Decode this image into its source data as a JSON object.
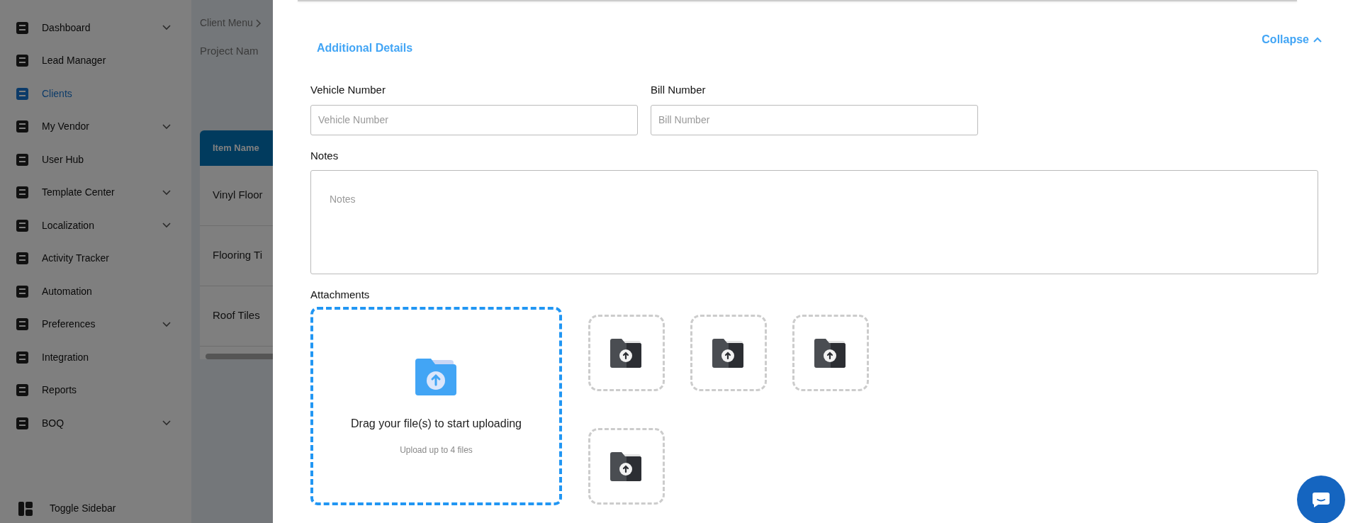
{
  "sidebar": {
    "items": [
      {
        "label": "Dashboard",
        "expandable": true,
        "selected": false
      },
      {
        "label": "Lead Manager",
        "expandable": false,
        "selected": false
      },
      {
        "label": "Clients",
        "expandable": false,
        "selected": true
      },
      {
        "label": "My Vendor",
        "expandable": true,
        "selected": false
      },
      {
        "label": "User Hub",
        "expandable": false,
        "selected": false
      },
      {
        "label": "Template Center",
        "expandable": true,
        "selected": false
      },
      {
        "label": "Localization",
        "expandable": true,
        "selected": false
      },
      {
        "label": "Activity Tracker",
        "expandable": false,
        "selected": false
      },
      {
        "label": "Automation",
        "expandable": false,
        "selected": false
      },
      {
        "label": "Preferences",
        "expandable": true,
        "selected": false
      },
      {
        "label": "Integration",
        "expandable": false,
        "selected": false
      },
      {
        "label": "Reports",
        "expandable": false,
        "selected": false
      },
      {
        "label": "BOQ",
        "expandable": true,
        "selected": false
      }
    ],
    "toggle": "Toggle Sidebar"
  },
  "background_page": {
    "breadcrumb": "Client Menu",
    "title": "Project Nam",
    "table": {
      "columns": [
        "Item Name"
      ],
      "rows": [
        "Vinyl Floor",
        "Flooring Ti",
        "Roof Tiles"
      ]
    }
  },
  "drawer": {
    "section_title": "Additional Details",
    "collapse": "Collapse",
    "fields": [
      {
        "label": "Vehicle Number",
        "placeholder": "Vehicle Number"
      },
      {
        "label": "Bill Number",
        "placeholder": "Bill Number"
      }
    ],
    "notes": {
      "label": "Notes",
      "placeholder": "Notes"
    },
    "attachments": {
      "label": "Attachments",
      "drop_title": "Drag your file(s) to start uploading",
      "drop_hint": "Upload up to 4 files",
      "slots": [
        {
          "kind": "upload"
        },
        {
          "kind": "upload"
        },
        {
          "kind": "upload"
        },
        {
          "kind": "upload"
        }
      ]
    }
  }
}
